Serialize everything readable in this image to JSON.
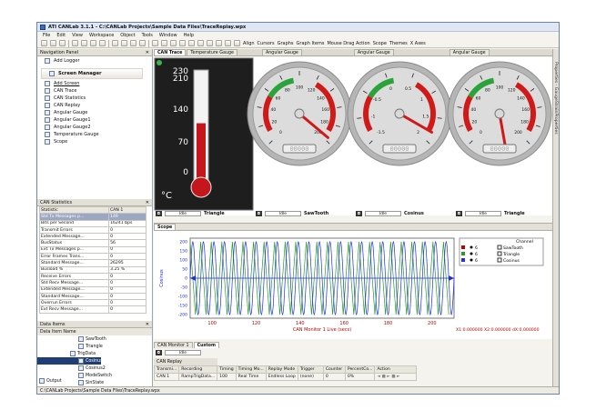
{
  "window": {
    "title": "ATI CANLab 3.1.1 - C:\\CANLab Projects\\Sample Data Files\\TraceReplay.wpx"
  },
  "menu": [
    "File",
    "Edit",
    "View",
    "Workspace",
    "Object",
    "Tools",
    "Window",
    "Help"
  ],
  "toolbar": {
    "align": "Align",
    "cursors": "Cursors",
    "graphs": "Graphs",
    "graph_items": "Graph Items",
    "mouse_drag": "Mouse Drag Action",
    "scope": "Scope",
    "themes": "Themes",
    "x_axes": "X Axes"
  },
  "nav": {
    "title": "Navigation Panel",
    "add_logger": "Add Logger",
    "section": "Screen Manager",
    "items": [
      "Add Screen",
      "CAN Trace",
      "CAN Statistics",
      "CAN Replay",
      "Angular Gauge",
      "Angular Gauge1",
      "Angular Gauge2",
      "Temperature Gauge",
      "Scope"
    ]
  },
  "stats": {
    "title": "CAN Statistics",
    "headers": [
      "Statistic",
      "CAN 1"
    ],
    "rows": [
      [
        "Std Tx Messages p...",
        "149"
      ],
      [
        "Bits per Second",
        "16241 bps"
      ],
      [
        "Transmit Errors",
        "0"
      ],
      [
        "Extended Message...",
        "0"
      ],
      [
        "BusStatus",
        "56"
      ],
      [
        "Ext Tx Messages p...",
        "0"
      ],
      [
        "Error Frames Trans...",
        "0"
      ],
      [
        "Standard Message...",
        "26295"
      ],
      [
        "Busload %",
        "3.25 %"
      ],
      [
        "Receive Errors",
        "0"
      ],
      [
        "Std Recv Message...",
        "0"
      ],
      [
        "Extended Message...",
        "0"
      ],
      [
        "Standard Message...",
        "0"
      ],
      [
        "Overrun Errors",
        "0"
      ],
      [
        "Ext Recv Message...",
        "0"
      ]
    ]
  },
  "data": {
    "title": "Data Items",
    "column": "Data Item Name",
    "items": [
      "SawTooth",
      "Triangle",
      "TrigData",
      "Cosinus",
      "Cosinus2",
      "ModeSwitch",
      "SinState"
    ]
  },
  "tabs": [
    "CAN Trace",
    "Temperature Gauge",
    "Angular Gauge",
    "Angular Gauge",
    "Angular Gauge"
  ],
  "temp": {
    "ticks": [
      "230",
      "210",
      "140",
      "70",
      "0"
    ],
    "unit": "°C",
    "level": 0.52
  },
  "gauges": [
    {
      "signal": "Triangle",
      "status": "Idle",
      "readout": "00000",
      "label_ticks": [
        "0",
        "20",
        "40",
        "60",
        "80",
        "100",
        "120",
        "140",
        "160",
        "180",
        "200"
      ]
    },
    {
      "signal": "SawTooth",
      "status": "Idle",
      "readout": "00000",
      "label_ticks": [
        "0",
        "20",
        "40",
        "60",
        "80",
        "100",
        "120",
        "140",
        "160",
        "180",
        "200"
      ]
    },
    {
      "signal": "Cosinus",
      "status": "Idle",
      "readout": "00000",
      "label_ticks": [
        "-1.5",
        "-1",
        "-0.5",
        "0",
        "0.5",
        "1",
        "1.5",
        "2"
      ]
    },
    {
      "signal": "Triangle",
      "status": "Idle",
      "readout": "00000",
      "label_ticks": [
        "0",
        "20",
        "40",
        "60",
        "80",
        "100",
        "120",
        "140",
        "160",
        "180",
        "200"
      ]
    }
  ],
  "scope": {
    "tab": "Scope",
    "ylabel": "Cosinus",
    "xlabel": "CAN Monitor 1 Live (secs)",
    "readout": "X1:0.000000 X2:0.000000 dX:0.000000",
    "yticks": [
      "200",
      "150",
      "100",
      "50",
      "0",
      "-50",
      "-100",
      "-150",
      "-200"
    ],
    "xticks": [
      "100",
      "120",
      "140",
      "160",
      "180",
      "200"
    ],
    "legend": {
      "header": "Channel",
      "rows": [
        {
          "idx": "6",
          "name": "SawTooth",
          "color": "#c00000"
        },
        {
          "idx": "6",
          "name": "Triangle",
          "color": "#20a020"
        },
        {
          "idx": "6",
          "name": "Cosinus",
          "color": "#2030e0"
        }
      ]
    }
  },
  "bottom": {
    "tabs": [
      "CAN Monitor 1",
      "Custom"
    ],
    "idle": "Idle",
    "replay_title": "CAN Replay",
    "headers": [
      "Transmi...",
      "Recording",
      "Timing",
      "Timing Mo...",
      "Replay Mode",
      "Trigger",
      "Counter",
      "PercentCo...",
      "Action"
    ],
    "row": [
      "CAN 1",
      "RampTrigData...",
      "100",
      "Real Time",
      "Endless Loop",
      "(none)",
      "0",
      "0%"
    ]
  },
  "right": {
    "label": "Properties - GaugeStrainProperties"
  },
  "output": "Output",
  "status": "C:\\CANLab Projects\\Sample Data Files\\TraceReplay.wpx",
  "chart_data": {
    "type": "line",
    "ylabel": "Cosinus",
    "xlabel": "CAN Monitor 1 Live (secs)",
    "ylim": [
      -220,
      220
    ],
    "xlim": [
      90,
      210
    ],
    "series": [
      {
        "name": "SawTooth",
        "color": "#c00000"
      },
      {
        "name": "Triangle",
        "color": "#20a020"
      },
      {
        "name": "Cosinus",
        "color": "#2030e0",
        "amplitude": 200,
        "period": 4.8
      }
    ]
  }
}
